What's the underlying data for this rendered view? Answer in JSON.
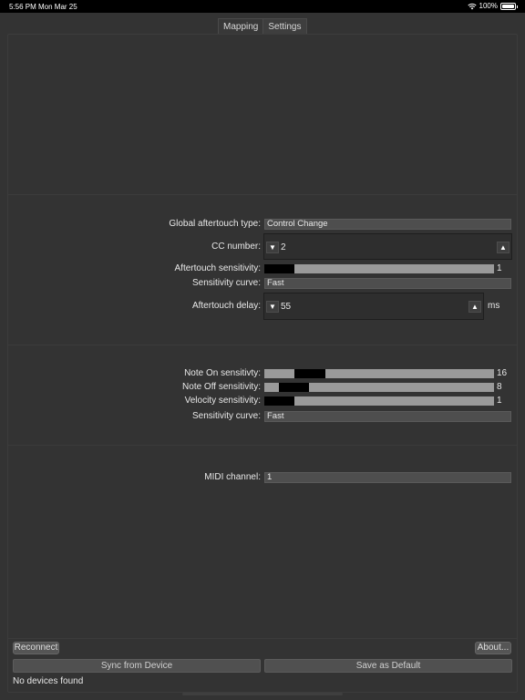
{
  "status": {
    "time": "5:56 PM",
    "date": "Mon Mar 25",
    "battery": "100%",
    "wifi_icon": "wifi-icon",
    "battery_icon": "battery-icon"
  },
  "tabs": [
    {
      "label": "Mapping",
      "active": false
    },
    {
      "label": "Settings",
      "active": true
    }
  ],
  "aftertouch": {
    "type_label": "Global aftertouch  type:",
    "type_value": "Control Change",
    "cc_label": "CC number:",
    "cc_value": "2",
    "sensitivity_label": "Aftertouch sensitivity:",
    "sensitivity_value": "1",
    "curve_label": "Sensitivity curve:",
    "curve_value": "Fast",
    "delay_label": "Aftertouch delay:",
    "delay_value": "55",
    "delay_unit": "ms"
  },
  "velocity": {
    "note_on_label": "Note On sensitivty:",
    "note_on_value": "16",
    "note_off_label": "Note Off sensitivity:",
    "note_off_value": "8",
    "velocity_label": "Velocity sensitivity:",
    "velocity_value": "1",
    "curve_label": "Sensitivity curve:",
    "curve_value": "Fast"
  },
  "midi": {
    "channel_label": "MIDI channel:",
    "channel_value": "1"
  },
  "footer": {
    "reconnect": "Reconnect",
    "about": "About...",
    "sync": "Sync from Device",
    "save_default": "Save as Default",
    "status": "No devices found"
  },
  "icons": {
    "spin_down": "▼",
    "spin_up": "▲"
  }
}
